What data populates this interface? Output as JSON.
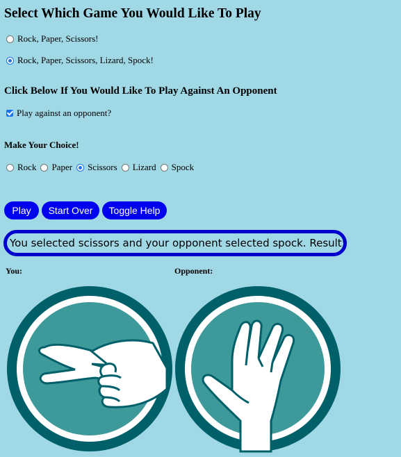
{
  "game_select": {
    "title": "Select Which Game You Would Like To Play",
    "options": [
      {
        "label": "Rock, Paper, Scissors!",
        "checked": false
      },
      {
        "label": "Rock, Paper, Scissors, Lizard, Spock!",
        "checked": true
      }
    ]
  },
  "opponent": {
    "title": "Click Below If You Would Like To Play Against An Opponent",
    "checkbox_label": "Play against an opponent?",
    "checked": true
  },
  "choice": {
    "title": "Make Your Choice!",
    "options": [
      {
        "label": "Rock",
        "checked": false
      },
      {
        "label": "Paper",
        "checked": false
      },
      {
        "label": "Scissors",
        "checked": true
      },
      {
        "label": "Lizard",
        "checked": false
      },
      {
        "label": "Spock",
        "checked": false
      }
    ]
  },
  "buttons": {
    "play": "Play",
    "start_over": "Start Over",
    "toggle_help": "Toggle Help"
  },
  "result_text": "You selected scissors and your opponent selected spock. Result: lose",
  "players": {
    "you_label": "You:",
    "opponent_label": "Opponent:",
    "you_icon": "scissors-hand-icon",
    "opponent_icon": "spock-hand-icon"
  },
  "colors": {
    "background": "#a0d8e5",
    "button": "#0000f0",
    "result_border": "#0000cc",
    "icon_dark": "#00606a",
    "icon_mid": "#3e9a9a"
  }
}
